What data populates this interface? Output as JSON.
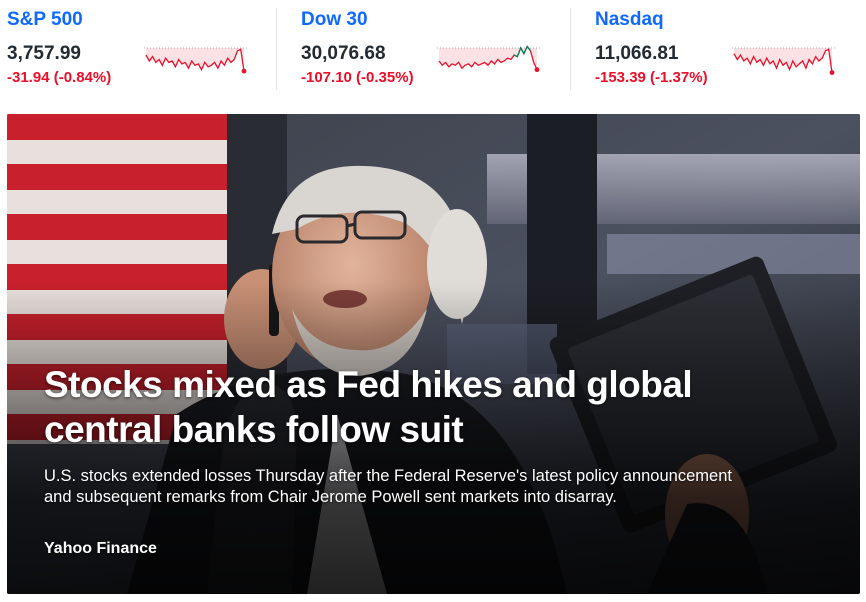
{
  "tickers": [
    {
      "name": "S&P 500",
      "price": "3,757.99",
      "change": "-31.94 (-0.84%)",
      "trend": "down",
      "spark": [
        0.35,
        0.55,
        0.4,
        0.6,
        0.5,
        0.7,
        0.45,
        0.6,
        0.55,
        0.75,
        0.5,
        0.65,
        0.6,
        0.8,
        0.55,
        0.7,
        0.65,
        0.85,
        0.6,
        0.75,
        0.7,
        0.6,
        0.8,
        0.55,
        0.7,
        0.45,
        0.6,
        0.5,
        0.2,
        0.15,
        0.9
      ]
    },
    {
      "name": "Dow 30",
      "price": "30,076.68",
      "change": "-107.10 (-0.35%)",
      "trend": "mixed",
      "spark": [
        0.55,
        0.7,
        0.6,
        0.75,
        0.65,
        0.7,
        0.6,
        0.8,
        0.7,
        0.65,
        0.75,
        0.6,
        0.7,
        0.65,
        0.6,
        0.7,
        0.55,
        0.65,
        0.5,
        0.6,
        0.55,
        0.45,
        0.5,
        0.35,
        0.4,
        0.1,
        0.3,
        0.05,
        0.2,
        0.6,
        0.85
      ]
    },
    {
      "name": "Nasdaq",
      "price": "11,066.81",
      "change": "-153.39 (-1.37%)",
      "trend": "down",
      "spark": [
        0.3,
        0.5,
        0.35,
        0.55,
        0.45,
        0.65,
        0.4,
        0.6,
        0.5,
        0.7,
        0.45,
        0.65,
        0.55,
        0.8,
        0.5,
        0.7,
        0.6,
        0.85,
        0.55,
        0.75,
        0.65,
        0.55,
        0.8,
        0.5,
        0.65,
        0.4,
        0.55,
        0.45,
        0.2,
        0.15,
        0.95
      ]
    }
  ],
  "colors": {
    "link": "#0f69ff",
    "negative": "#eb0f29",
    "positive": "#00875a",
    "baseline": "#eb0f29"
  },
  "hero": {
    "headline": "Stocks mixed as Fed hikes and global central banks follow suit",
    "summary": "U.S. stocks extended losses Thursday after the Federal Reserve's latest policy announcement and subsequent remarks from Chair Jerome Powell sent markets into disarray.",
    "source": "Yahoo Finance"
  }
}
